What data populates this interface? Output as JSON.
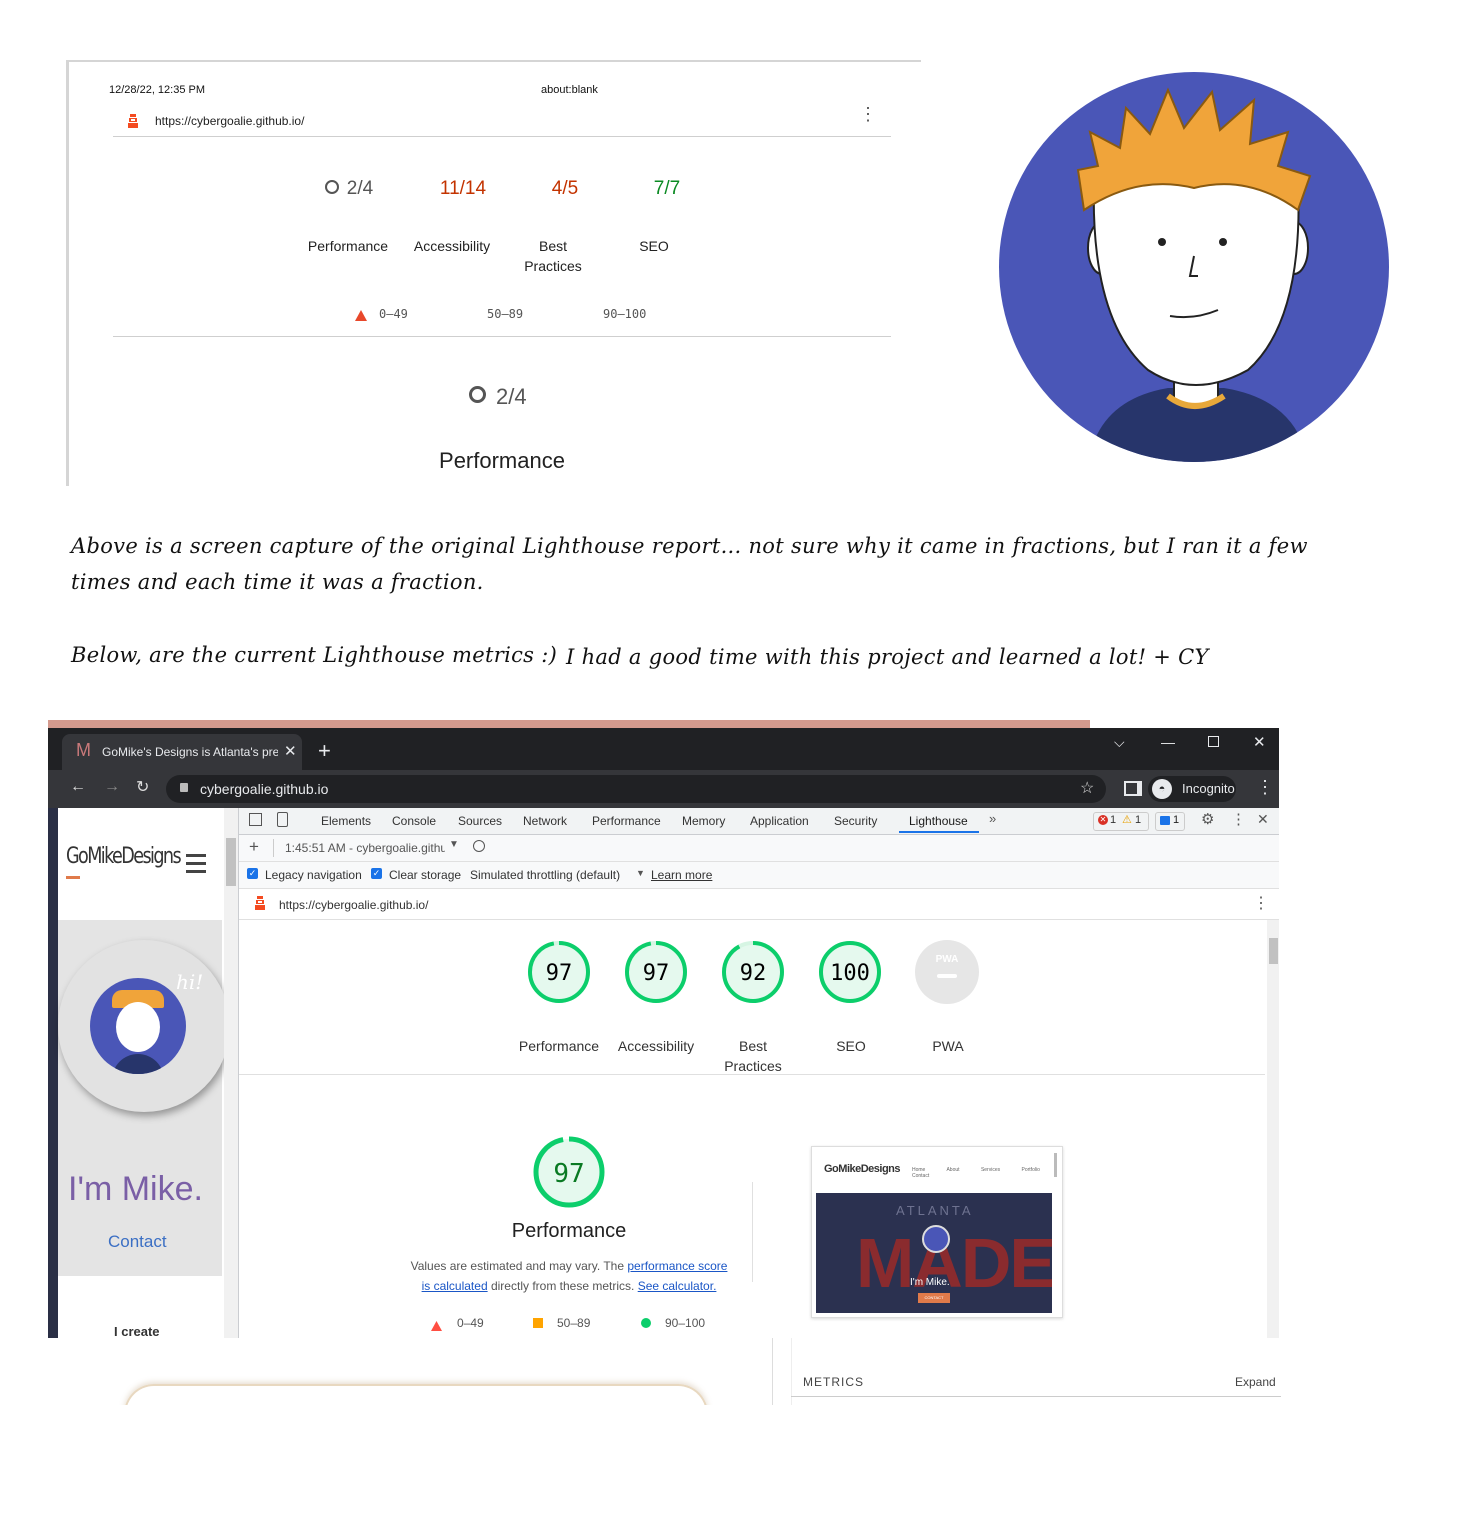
{
  "old_report": {
    "timestamp": "12/28/22, 12:35 PM",
    "page_title": "about:blank",
    "url": "https://cybergoalie.github.io/",
    "scores": [
      {
        "value": "2/4",
        "label": "Performance",
        "color": "#555555"
      },
      {
        "value": "11/14",
        "label": "Accessibility",
        "color": "#c33300"
      },
      {
        "value": "4/5",
        "label": "Best Practices",
        "color": "#c33300"
      },
      {
        "value": "7/7",
        "label": "SEO",
        "color": "#0a8a22"
      }
    ],
    "legend": [
      "0–49",
      "50–89",
      "90–100"
    ],
    "featured_score": "2/4",
    "featured_label": "Performance"
  },
  "notes": {
    "line1": "Above is a screen capture of the original Lighthouse report... not sure why it came in fractions, but I ran it a few",
    "line2": "times and each time it was a fraction.",
    "line3": "Below, are the current Lighthouse metrics :)",
    "line3b": "I had a good time with this project and learned a lot!  + CY"
  },
  "browser": {
    "tab_title": "GoMike's Designs is Atlanta's pre",
    "address": "cybergoalie.github.io",
    "incognito_label": "Incognito"
  },
  "site": {
    "logo": "GoMikeDesigns",
    "hi": "hi!",
    "heading": "I'm Mike.",
    "contact": "Contact",
    "create": "I create"
  },
  "devtools": {
    "tabs": [
      "Elements",
      "Console",
      "Sources",
      "Network",
      "Performance",
      "Memory",
      "Application",
      "Security",
      "Lighthouse"
    ],
    "active_tab": "Lighthouse",
    "error_count": "1",
    "warning_count": "1",
    "message_count": "1",
    "report_selector": "1:45:51 AM - cybergoalie.githu",
    "legacy_navigation": "Legacy navigation",
    "clear_storage": "Clear storage",
    "throttling": "Simulated throttling (default)",
    "learn_more": "Learn more",
    "url": "https://cybergoalie.github.io/",
    "scores": [
      {
        "value": 97,
        "label": "Performance"
      },
      {
        "value": 97,
        "label": "Accessibility"
      },
      {
        "value": 92,
        "label": "Best Practices"
      },
      {
        "value": 100,
        "label": "SEO"
      }
    ],
    "pwa_label": "PWA",
    "pwa_badge": "PWA",
    "perf_score": 97,
    "perf_title": "Performance",
    "perf_desc_1": "Values are estimated and may vary. The",
    "perf_link_1": "performance score",
    "perf_link_2": "is calculated",
    "perf_desc_2": "directly from these metrics.",
    "perf_link_3": "See calculator.",
    "legend": [
      "0–49",
      "50–89",
      "90–100"
    ],
    "metrics_label": "METRICS",
    "expand_label": "Expand",
    "thumbnail": {
      "logo": "GoMikeDesigns",
      "nav": [
        "Home",
        "About",
        "Services",
        "Portfolio",
        "Contact"
      ],
      "bg_text": "MADE",
      "bg_small": "ATLANTA",
      "caption": "I'm Mike.",
      "button": "CONTACT"
    }
  },
  "colors": {
    "pass": "#0cce6b",
    "pass_text": "#0a7a23",
    "average": "#ffa400",
    "fail": "#ff4e42",
    "avatar_bg": "#4a56b7",
    "site_purple": "#7a5fa6"
  }
}
